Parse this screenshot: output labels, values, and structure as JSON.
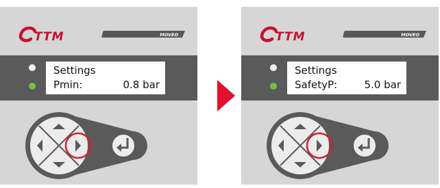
{
  "brand": {
    "logo_text": "TTM",
    "product_strip_text": "MOVEO",
    "logo_color": "#c8102e"
  },
  "colors": {
    "panel": "#d6d6d6",
    "display_band": "#5a5a5a",
    "led_white": "#f2f2f2",
    "led_green": "#76c043",
    "highlight_ring": "#d0202a",
    "transition_arrow": "#e0102e"
  },
  "panels": [
    {
      "display": {
        "line1": "Settings",
        "line2_label": "Pmin:",
        "line2_value": "0.8 bar"
      },
      "highlighted_key": "right-arrow-key"
    },
    {
      "display": {
        "line1": "Settings",
        "line2_label": "SafetyP:",
        "line2_value": "5.0 bar"
      },
      "highlighted_key": "right-arrow-key"
    }
  ],
  "icons": {
    "up": "triangle-up-icon",
    "down": "triangle-down-icon",
    "left": "triangle-left-icon",
    "right": "triangle-right-icon",
    "enter": "enter-return-icon",
    "transition": "triangle-right-icon"
  }
}
